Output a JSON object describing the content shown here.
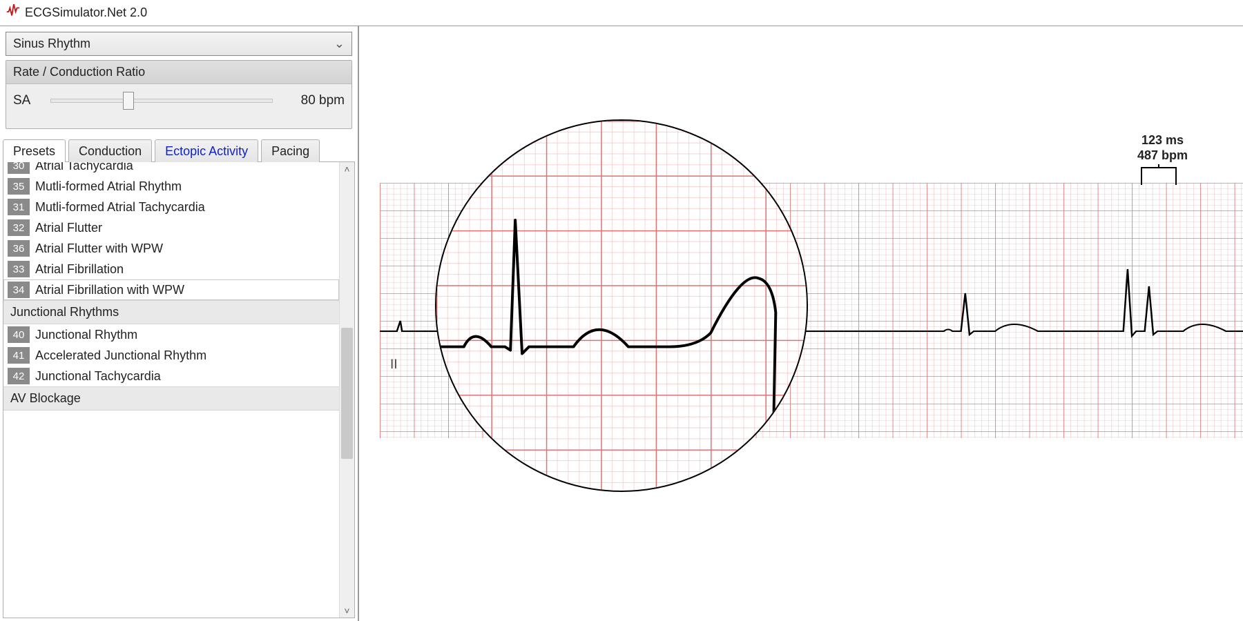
{
  "title": "ECGSimulator.Net 2.0",
  "rhythm_dropdown": {
    "selected": "Sinus Rhythm"
  },
  "rate_panel": {
    "title": "Rate / Conduction Ratio",
    "sa_label": "SA",
    "rate_value": "80 bpm"
  },
  "tabs": {
    "presets": "Presets",
    "conduction": "Conduction",
    "ectopic": "Ectopic Activity",
    "pacing": "Pacing"
  },
  "presets": {
    "cut_item": {
      "num": "30",
      "label": "Atrial Tachycardia"
    },
    "items_a": [
      {
        "num": "35",
        "label": "Mutli-formed Atrial Rhythm"
      },
      {
        "num": "31",
        "label": "Mutli-formed Atrial Tachycardia"
      },
      {
        "num": "32",
        "label": "Atrial Flutter"
      },
      {
        "num": "36",
        "label": "Atrial Flutter with WPW"
      },
      {
        "num": "33",
        "label": "Atrial Fibrillation"
      }
    ],
    "selected": {
      "num": "34",
      "label": "Atrial Fibrillation with WPW"
    },
    "cat_junctional": "Junctional Rhythms",
    "items_b": [
      {
        "num": "40",
        "label": "Junctional Rhythm"
      },
      {
        "num": "41",
        "label": "Accelerated Junctional Rhythm"
      },
      {
        "num": "42",
        "label": "Junctional Tachycardia"
      }
    ],
    "cat_av": "AV Blockage"
  },
  "lead_label": "II",
  "caliper": {
    "ms": "123 ms",
    "bpm": "487 bpm"
  },
  "colors": {
    "grid_minor": "#f3c4c4",
    "grid_major": "#e77d7d",
    "trace": "#000"
  }
}
